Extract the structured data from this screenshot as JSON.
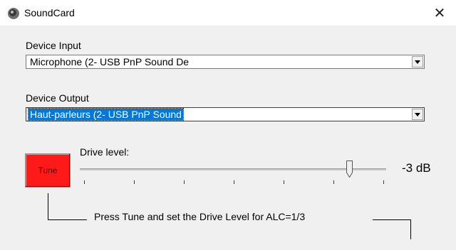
{
  "window": {
    "title": "SoundCard",
    "close_glyph": "✕"
  },
  "device_input": {
    "label": "Device Input",
    "value": "Microphone (2- USB PnP Sound De"
  },
  "device_output": {
    "label": "Device Output",
    "value": "Haut-parleurs (2- USB PnP Sound"
  },
  "tune": {
    "label": "Tune",
    "color": "#ff1a1a"
  },
  "drive": {
    "label": "Drive level:",
    "value_text": "-3 dB",
    "slider_level": 0.88,
    "tick_count": 7
  },
  "hint": "Press Tune and set the Drive Level for ALC=1/3",
  "colors": {
    "selection": "#0078d7",
    "background": "#f0f0f0"
  }
}
